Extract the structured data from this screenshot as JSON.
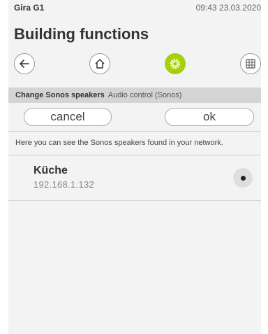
{
  "status": {
    "app_name": "Gira G1",
    "datetime": "09:43 23.03.2020"
  },
  "page": {
    "title": "Building functions"
  },
  "nav": {
    "icons": [
      "back-arrow-icon",
      "home-icon",
      "gear-icon",
      "grid-icon"
    ],
    "active_color": "#a8cf0d"
  },
  "dialog": {
    "header_bold": "Change Sonos speakers",
    "header_sub": "Audio control (Sonos)",
    "cancel_label": "cancel",
    "ok_label": "ok",
    "info_text": "Here you can see the Sonos speakers found in your network.",
    "speakers": [
      {
        "name": "Küche",
        "ip": "192.168.1.132",
        "selected": true
      }
    ]
  }
}
